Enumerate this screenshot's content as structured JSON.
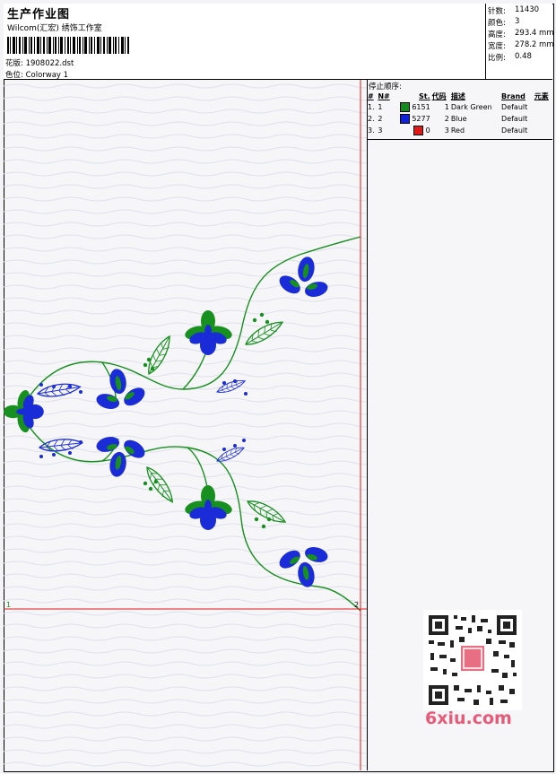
{
  "header": {
    "title": "生产作业图",
    "subtitle": "Wilcom(汇宏) 绣饰工作室",
    "design_label": "花版:",
    "design_value": "1908022.dst",
    "colorway_label": "色位:",
    "colorway_value": "Colorway 1"
  },
  "stats": [
    {
      "label": "针数:",
      "value": "11430"
    },
    {
      "label": "颜色:",
      "value": "3"
    },
    {
      "label": "高度:",
      "value": "293.4 mm"
    },
    {
      "label": "宽度:",
      "value": "278.2 mm"
    },
    {
      "label": "比例:",
      "value": "0.48"
    }
  ],
  "stop_sequence": {
    "heading": "停止顺序:",
    "columns": [
      "#",
      "N#",
      "St.",
      "代码",
      "描述",
      "Brand",
      "元素"
    ],
    "rows": [
      {
        "idx": "1.",
        "n": "1",
        "color": "#138a1e",
        "st": "6151",
        "code": "1",
        "desc": "Dark Green",
        "brand": "Default"
      },
      {
        "idx": "2.",
        "n": "2",
        "color": "#1020d8",
        "st": "5277",
        "code": "2",
        "desc": "Blue",
        "brand": "Default"
      },
      {
        "idx": "3.",
        "n": "3",
        "color": "#e01818",
        "st": "0",
        "code": "3",
        "desc": "Red",
        "brand": "Default"
      }
    ]
  },
  "canvas": {
    "marker_left": "1",
    "marker_right": "2",
    "guide_color": "#e01818"
  },
  "watermark": {
    "text": "6xiu.com"
  }
}
